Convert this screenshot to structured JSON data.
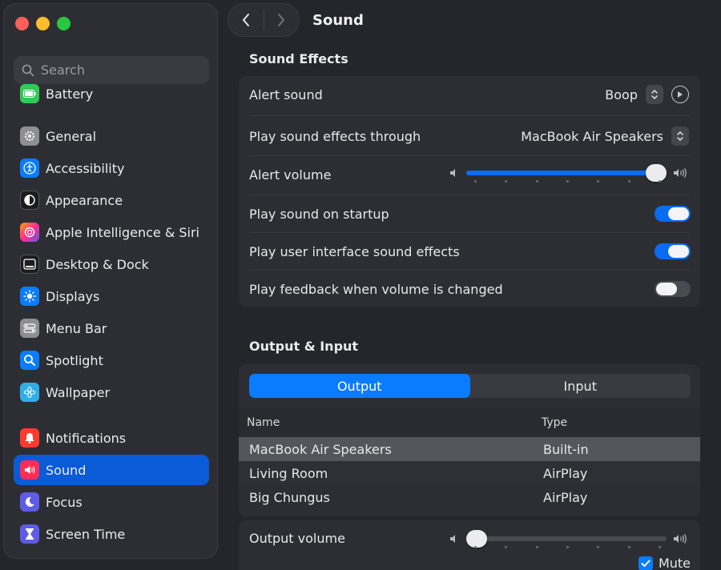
{
  "window": {
    "title": "Sound"
  },
  "sidebar": {
    "search_placeholder": "Search",
    "items": [
      {
        "label": "Battery",
        "icon": "battery-icon",
        "color": "#34c759"
      },
      {
        "label": "General",
        "icon": "gear-icon",
        "color": "#8e8e93"
      },
      {
        "label": "Accessibility",
        "icon": "accessibility-icon",
        "color": "#0a7cff"
      },
      {
        "label": "Appearance",
        "icon": "appearance-icon",
        "color": "#1c1c1e"
      },
      {
        "label": "Apple Intelligence & Siri",
        "icon": "siri-icon",
        "color": "#ff6fb5"
      },
      {
        "label": "Desktop & Dock",
        "icon": "dock-icon",
        "color": "#1c1c1e"
      },
      {
        "label": "Displays",
        "icon": "sun-icon",
        "color": "#0a7cff"
      },
      {
        "label": "Menu Bar",
        "icon": "menu-bar-icon",
        "color": "#8e8e93"
      },
      {
        "label": "Spotlight",
        "icon": "magnifier-icon",
        "color": "#0a7cff"
      },
      {
        "label": "Wallpaper",
        "icon": "flower-icon",
        "color": "#32ade6"
      },
      {
        "label": "Notifications",
        "icon": "bell-icon",
        "color": "#ff3b30"
      },
      {
        "label": "Sound",
        "icon": "speaker-icon",
        "color": "#ff2d55"
      },
      {
        "label": "Focus",
        "icon": "moon-icon",
        "color": "#5e5ce6"
      },
      {
        "label": "Screen Time",
        "icon": "hourglass-icon",
        "color": "#5e5ce6"
      }
    ],
    "selected": "Sound"
  },
  "sound_effects": {
    "title": "Sound Effects",
    "alert_sound_label": "Alert sound",
    "alert_sound_value": "Boop",
    "play_through_label": "Play sound effects through",
    "play_through_value": "MacBook Air Speakers",
    "alert_volume_label": "Alert volume",
    "alert_volume_level": 1.0,
    "startup_label": "Play sound on startup",
    "startup_on": true,
    "ui_effects_label": "Play user interface sound effects",
    "ui_effects_on": true,
    "feedback_label": "Play feedback when volume is changed",
    "feedback_on": false
  },
  "output_input": {
    "title": "Output & Input",
    "tabs": [
      "Output",
      "Input"
    ],
    "active_tab": "Output",
    "columns": [
      "Name",
      "Type"
    ],
    "devices": [
      {
        "name": "MacBook Air Speakers",
        "type": "Built-in",
        "selected": true
      },
      {
        "name": "Living Room",
        "type": "AirPlay",
        "selected": false
      },
      {
        "name": "Big Chungus",
        "type": "AirPlay",
        "selected": false
      }
    ],
    "output_volume_label": "Output volume",
    "output_volume_level": 0.0,
    "mute_label": "Mute",
    "mute_checked": true
  },
  "colors": {
    "accent": "#0a7cff",
    "toggle_on": "#0a6cf0"
  }
}
